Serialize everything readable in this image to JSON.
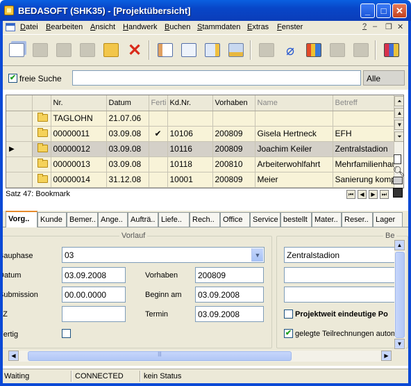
{
  "window": {
    "title": "BEDASOFT (SHK35) - [Projektübersicht]"
  },
  "menu": [
    "Datei",
    "Bearbeiten",
    "Ansicht",
    "Handwerk",
    "Buchen",
    "Stammdaten",
    "Extras",
    "Fenster"
  ],
  "menu_help": "?",
  "search": {
    "checkbox_label": "freie Suche",
    "checked": true,
    "value": "",
    "scope": "Alle"
  },
  "grid": {
    "columns": [
      "",
      "",
      "Nr.",
      "Datum",
      "Ferti",
      "Kd.Nr.",
      "Vorhaben",
      "Name",
      "Betreff"
    ],
    "rows": [
      {
        "nr": "TAGLOHN",
        "datum": "21.07.06",
        "fertig": "",
        "kdnr": "",
        "vorhaben": "",
        "name": "",
        "betreff": ""
      },
      {
        "nr": "00000011",
        "datum": "03.09.08",
        "fertig": "✔",
        "kdnr": "10106",
        "vorhaben": "200809",
        "name": "Gisela Hertneck",
        "betreff": "EFH"
      },
      {
        "nr": "00000012",
        "datum": "03.09.08",
        "fertig": "",
        "kdnr": "10116",
        "vorhaben": "200809",
        "name": "Joachim Keiler",
        "betreff": "Zentralstadion"
      },
      {
        "nr": "00000013",
        "datum": "03.09.08",
        "fertig": "",
        "kdnr": "10118",
        "vorhaben": "200810",
        "name": "Arbeiterwohlfahrt",
        "betreff": "Mehrfamilienhau"
      },
      {
        "nr": "00000014",
        "datum": "31.12.08",
        "fertig": "",
        "kdnr": "10001",
        "vorhaben": "200809",
        "name": "Meier",
        "betreff": "Sanierung komp"
      }
    ],
    "status": "Satz 47: Bookmark"
  },
  "tabs": [
    "Vorg..",
    "Kunde",
    "Bemer..",
    "Ange..",
    "Aufträ..",
    "Liefe..",
    "Rech..",
    "Office",
    "Service",
    "bestellt",
    "Mater..",
    "Reser..",
    "Lager"
  ],
  "vorlauf": {
    "legend": "Vorlauf",
    "bauphase_label": "Bauphase",
    "bauphase_value": "03",
    "datum_label": "Datum",
    "datum_value": "03.09.2008",
    "submission_label": "Submission",
    "submission_value": "00.00.0000",
    "lz_label": "LZ",
    "lz_value": "",
    "fertig_label": "Fertig",
    "vorhaben_label": "Vorhaben",
    "vorhaben_value": "200809",
    "beginn_label": "Beginn am",
    "beginn_value": "03.09.2008",
    "termin_label": "Termin",
    "termin_value": "03.09.2008"
  },
  "right_panel": {
    "legend": "Be",
    "betreff_value": "Zentralstadion",
    "projekt_label": "Projektweit eindeutige Po",
    "teilrechnungen_label": "gelegte Teilrechnungen autom"
  },
  "statusbar": {
    "state": "Waiting",
    "connection": "CONNECTED",
    "status": "kein Status"
  }
}
